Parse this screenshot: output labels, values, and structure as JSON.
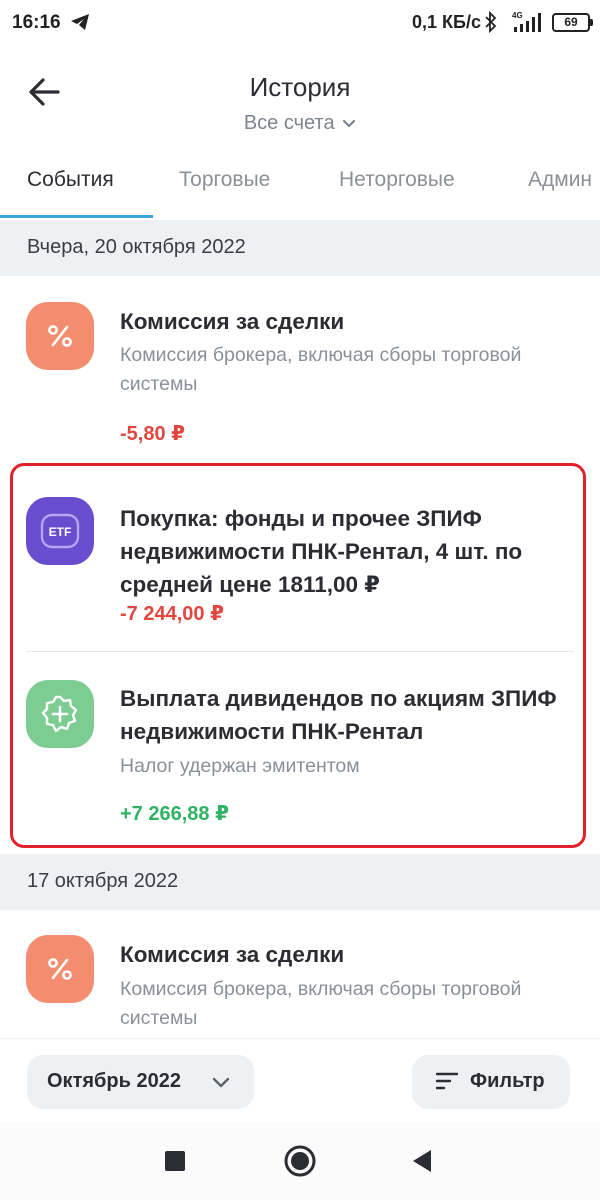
{
  "status_bar": {
    "time": "16:16",
    "net_speed": "0,1 КБ/с",
    "network_type": "4G",
    "battery": "69",
    "icons": [
      "telegram-icon",
      "bluetooth-icon",
      "signal-icon",
      "battery-icon"
    ]
  },
  "header": {
    "title": "История",
    "account_selector": "Все счета",
    "back_icon": "arrow-left-icon"
  },
  "tabs": [
    {
      "label": "События",
      "active": true
    },
    {
      "label": "Торговые",
      "active": false
    },
    {
      "label": "Неторговые",
      "active": false
    },
    {
      "label": "Админ",
      "active": false
    }
  ],
  "sections": [
    {
      "date": "Вчера, 20 октября 2022",
      "events": [
        {
          "icon": "percent-icon",
          "title": "Комиссия за сделки",
          "subtitle": "Комиссия брокера, включая сборы торговой системы",
          "amount": "-5,80 ₽"
        },
        {
          "icon": "etf-icon",
          "icon_text": "ETF",
          "title": "Покупка: фонды и прочее ЗПИФ недвижимости ПНК-Рентал, 4 шт. по средней цене 1811,00 ₽",
          "amount": "-7 244,00 ₽"
        },
        {
          "icon": "dividend-plus-icon",
          "title": "Выплата дивидендов по акциям ЗПИФ недвижимости ПНК-Рентал",
          "subtitle": "Налог удержан эмитентом",
          "amount": "+7 266,88 ₽"
        }
      ]
    },
    {
      "date": "17 октября 2022",
      "events": [
        {
          "icon": "percent-icon",
          "title": "Комиссия за сделки",
          "subtitle": "Комиссия брокера, включая сборы торговой системы"
        }
      ]
    }
  ],
  "bottom_bar": {
    "month_button": "Октябрь 2022",
    "filter_button": "Фильтр"
  },
  "colors": {
    "accent": "#3aa3dc",
    "negative": "#e2473f",
    "positive": "#2fb264",
    "highlight": "#e0202b",
    "icon_orange": "#f48d6f",
    "icon_purple": "#6a4dcf",
    "icon_green": "#7dcc92"
  },
  "nav_bar": {
    "icons": [
      "recents-square-icon",
      "home-circle-icon",
      "back-triangle-icon"
    ]
  }
}
